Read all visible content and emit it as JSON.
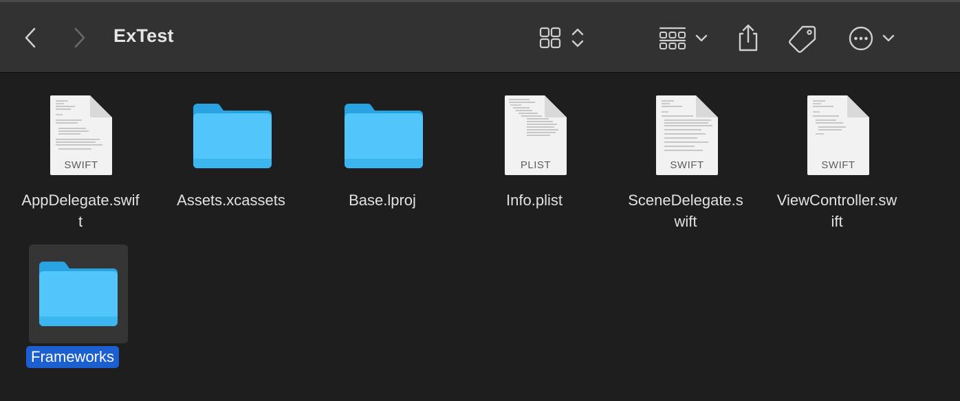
{
  "window": {
    "title": "ExTest"
  },
  "toolbar": {
    "back_icon": "chevron-left-icon",
    "forward_icon": "chevron-right-icon",
    "view_icon": "grid-view-icon",
    "group_icon": "group-by-icon",
    "share_icon": "share-icon",
    "tag_icon": "tag-icon",
    "more_icon": "ellipsis-circle-icon"
  },
  "files": [
    {
      "name": "AppDelegate.swif\nt",
      "kind": "document",
      "badge": "SWIFT"
    },
    {
      "name": "Assets.xcassets",
      "kind": "folder"
    },
    {
      "name": "Base.lproj",
      "kind": "folder"
    },
    {
      "name": "Info.plist",
      "kind": "document",
      "badge": "PLIST"
    },
    {
      "name": "SceneDelegate.s\nwift",
      "kind": "document",
      "badge": "SWIFT"
    },
    {
      "name": "ViewController.sw\nift",
      "kind": "document",
      "badge": "SWIFT"
    },
    {
      "name": "Frameworks",
      "kind": "folder",
      "selected": true
    }
  ],
  "colors": {
    "toolbar_bg": "#323232",
    "content_bg": "#1e1e1e",
    "folder_blue": "#4cc3f6",
    "selection_blue": "#1b5fd1"
  }
}
